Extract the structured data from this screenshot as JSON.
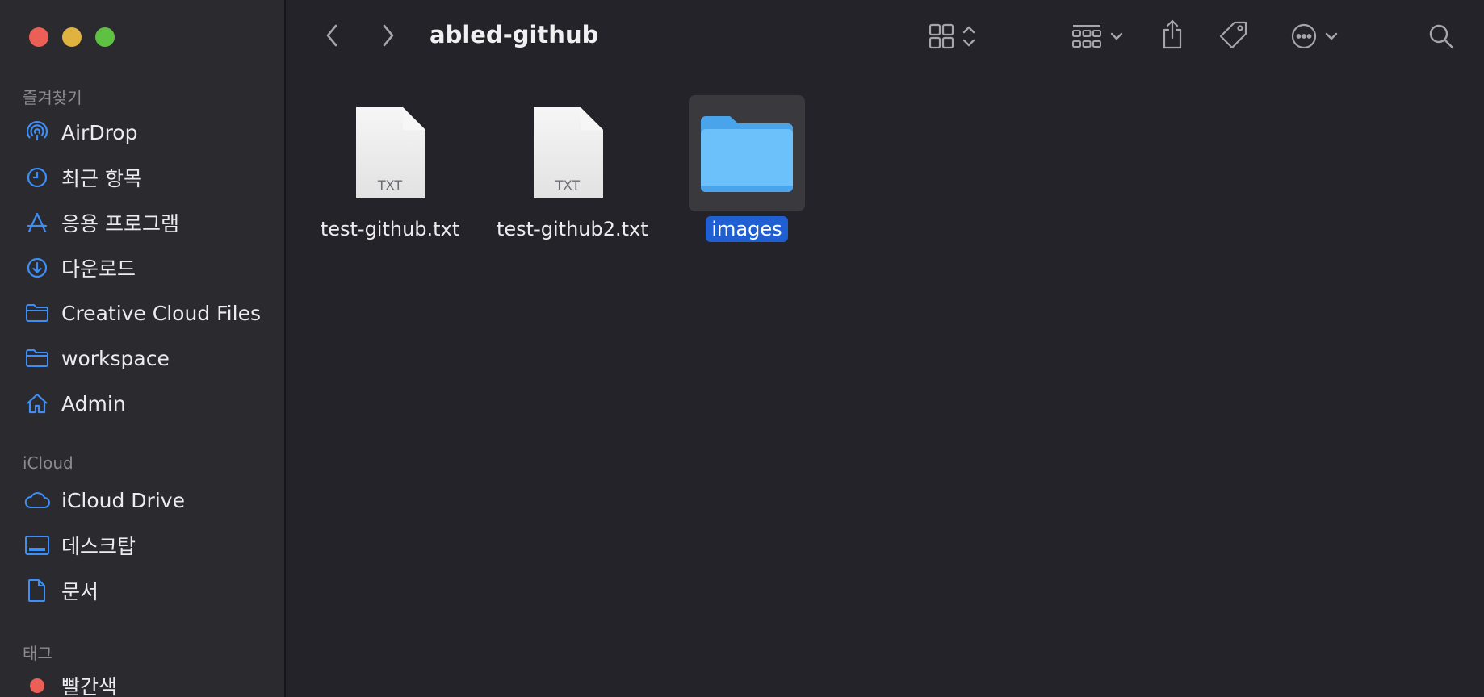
{
  "window": {
    "title": "abled-github"
  },
  "sidebar": {
    "sections": [
      {
        "heading": "즐겨찾기",
        "items": [
          {
            "label": "AirDrop",
            "icon": "airdrop-icon"
          },
          {
            "label": "최근 항목",
            "icon": "clock-icon"
          },
          {
            "label": "응용 프로그램",
            "icon": "apps-icon"
          },
          {
            "label": "다운로드",
            "icon": "download-icon"
          },
          {
            "label": "Creative Cloud Files",
            "icon": "folder-icon"
          },
          {
            "label": "workspace",
            "icon": "folder-icon"
          },
          {
            "label": "Admin",
            "icon": "home-icon"
          }
        ]
      },
      {
        "heading": "iCloud",
        "items": [
          {
            "label": "iCloud Drive",
            "icon": "cloud-icon"
          },
          {
            "label": "데스크탑",
            "icon": "desktop-icon"
          },
          {
            "label": "문서",
            "icon": "document-icon"
          }
        ]
      },
      {
        "heading": "태그",
        "items": [
          {
            "label": "빨간색",
            "icon": "tag-dot-icon",
            "color": "#ec5f57"
          }
        ]
      }
    ]
  },
  "files": [
    {
      "name": "test-github.txt",
      "kind": "TXT",
      "selected": false
    },
    {
      "name": "test-github2.txt",
      "kind": "TXT",
      "selected": false
    },
    {
      "name": "images",
      "kind": "folder",
      "selected": true
    }
  ],
  "colors": {
    "accent": "#1f5fd2",
    "sidebar_icon": "#3d8ef7",
    "folder": "#5eb5f7"
  }
}
